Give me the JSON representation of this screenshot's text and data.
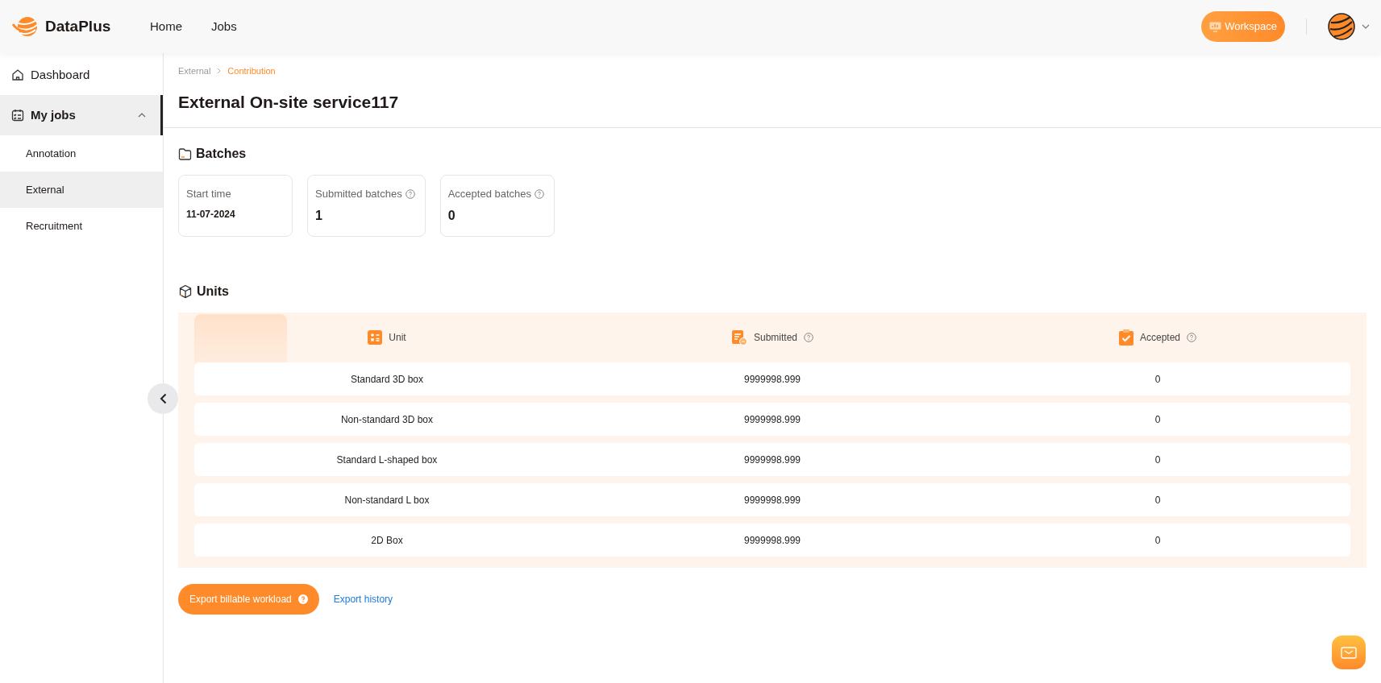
{
  "header": {
    "brand": "DataPlus",
    "nav": [
      {
        "label": "Home",
        "selected": false
      },
      {
        "label": "Jobs",
        "selected": false
      }
    ],
    "workspace_button": "Workspace"
  },
  "sidebar": {
    "items": [
      {
        "label": "Dashboard",
        "selected": false
      },
      {
        "label": "My jobs",
        "selected": true,
        "expanded": true,
        "children": [
          {
            "label": "Annotation",
            "selected": false
          },
          {
            "label": "External",
            "selected": true
          },
          {
            "label": "Recruitment",
            "selected": false
          }
        ]
      }
    ]
  },
  "breadcrumb": [
    {
      "label": "External",
      "current": false
    },
    {
      "label": "Contribution",
      "current": true
    }
  ],
  "title": "External On-site service117",
  "batches": {
    "heading": "Batches",
    "cards": [
      {
        "label": "Start time",
        "value": "11-07-2024",
        "help": false,
        "kind": "date"
      },
      {
        "label": "Submitted batches",
        "value": "1",
        "help": true,
        "kind": "count"
      },
      {
        "label": "Accepted batches",
        "value": "0",
        "help": true,
        "kind": "count"
      }
    ]
  },
  "units": {
    "heading": "Units",
    "columns": [
      {
        "label": "Unit",
        "help": false
      },
      {
        "label": "Submitted",
        "help": true
      },
      {
        "label": "Accepted",
        "help": true
      }
    ],
    "rows": [
      [
        "Standard 3D box",
        "9999998.999",
        "0"
      ],
      [
        "Non-standard 3D box",
        "9999998.999",
        "0"
      ],
      [
        "Standard L-shaped box",
        "9999998.999",
        "0"
      ],
      [
        "Non-standard L box",
        "9999998.999",
        "0"
      ],
      [
        "2D Box",
        "9999998.999",
        "0"
      ]
    ]
  },
  "actions": {
    "export_button": "Export billable workload",
    "history_link": "Export history"
  }
}
